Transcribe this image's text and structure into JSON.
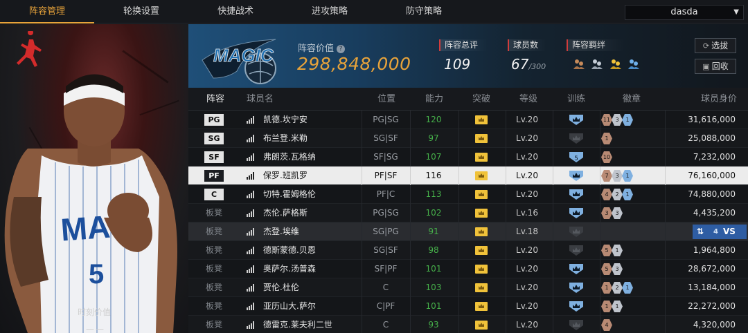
{
  "tabs": [
    {
      "label": "阵容管理",
      "active": true
    },
    {
      "label": "轮换设置",
      "active": false
    },
    {
      "label": "快捷战术",
      "active": false
    },
    {
      "label": "进攻策略",
      "active": false
    },
    {
      "label": "防守策略",
      "active": false
    }
  ],
  "account": {
    "selected": "dasda"
  },
  "portrait": {
    "moment_label": "时刻价值",
    "moment_value": "——"
  },
  "team": {
    "value_label": "阵容价值",
    "value": "298,848,000",
    "rating_label": "阵容总评",
    "rating": "109",
    "players_label": "球员数",
    "players": "67",
    "players_max": "/300",
    "bond_label": "阵容羁绊",
    "bond_icons": [
      "bond-icon-1",
      "bond-icon-2",
      "bond-icon-3",
      "bond-icon-4"
    ],
    "select_label": "选拔",
    "recycle_label": "回收"
  },
  "table": {
    "headers": [
      "阵容",
      "球员名",
      "位置",
      "能力",
      "突破",
      "等级",
      "训练",
      "徽章",
      "球员身价"
    ],
    "rows": [
      {
        "slot": "PG",
        "name": "凯德.坎宁安",
        "pos": "PG|SG",
        "ability": "120",
        "level": "Lv.20",
        "badges": [
          {
            "n": "11",
            "t": "b"
          },
          {
            "n": "3",
            "t": "s"
          },
          {
            "n": "1",
            "t": "g"
          }
        ],
        "price": "31,616,000",
        "train": "active"
      },
      {
        "slot": "SG",
        "name": "布兰登.米勒",
        "pos": "SG|SF",
        "ability": "97",
        "level": "Lv.20",
        "badges": [
          {
            "n": "1",
            "t": "b"
          }
        ],
        "price": "25,088,000",
        "train": "inactive"
      },
      {
        "slot": "SF",
        "name": "弗朗茨.瓦格纳",
        "pos": "SF|SG",
        "ability": "107",
        "level": "Lv.20",
        "badges": [
          {
            "n": "10",
            "t": "b"
          }
        ],
        "price": "7,232,000",
        "train": "number",
        "train_num": "5"
      },
      {
        "slot": "PF",
        "name": "保罗.班凯罗",
        "pos": "PF|SF",
        "ability": "116",
        "level": "Lv.20",
        "badges": [
          {
            "n": "7",
            "t": "b"
          },
          {
            "n": "3",
            "t": "s"
          },
          {
            "n": "1",
            "t": "g"
          }
        ],
        "price": "76,160,000",
        "train": "active"
      },
      {
        "slot": "C",
        "name": "切特.霍姆格伦",
        "pos": "PF|C",
        "ability": "113",
        "level": "Lv.20",
        "badges": [
          {
            "n": "4",
            "t": "b"
          },
          {
            "n": "2",
            "t": "s"
          },
          {
            "n": "1",
            "t": "g"
          }
        ],
        "price": "74,880,000",
        "train": "active"
      },
      {
        "slot": "板凳",
        "name": "杰伦.萨格斯",
        "pos": "PG|SG",
        "ability": "102",
        "level": "Lv.16",
        "badges": [
          {
            "n": "3",
            "t": "b"
          },
          {
            "n": "3",
            "t": "s"
          }
        ],
        "price": "4,435,200",
        "train": "active"
      },
      {
        "slot": "板凳",
        "name": "杰登.埃维",
        "pos": "SG|PG",
        "ability": "91",
        "level": "Lv.18",
        "badges": [],
        "price": "",
        "train": "inactive",
        "swap": true
      },
      {
        "slot": "板凳",
        "name": "德斯蒙德.贝恩",
        "pos": "SG|SF",
        "ability": "98",
        "level": "Lv.20",
        "badges": [
          {
            "n": "5",
            "t": "b"
          },
          {
            "n": "1",
            "t": "s"
          }
        ],
        "price": "1,964,800",
        "train": "inactive"
      },
      {
        "slot": "板凳",
        "name": "奥萨尔.汤普森",
        "pos": "SF|PF",
        "ability": "101",
        "level": "Lv.20",
        "badges": [
          {
            "n": "5",
            "t": "b"
          },
          {
            "n": "3",
            "t": "s"
          }
        ],
        "price": "28,672,000",
        "train": "active"
      },
      {
        "slot": "板凳",
        "name": "贾伦.杜伦",
        "pos": "C",
        "ability": "103",
        "level": "Lv.20",
        "badges": [
          {
            "n": "1",
            "t": "b"
          },
          {
            "n": "2",
            "t": "s"
          },
          {
            "n": "1",
            "t": "g"
          }
        ],
        "price": "13,184,000",
        "train": "active"
      },
      {
        "slot": "板凳",
        "name": "亚历山大.萨尔",
        "pos": "C|PF",
        "ability": "101",
        "level": "Lv.20",
        "badges": [
          {
            "n": "1",
            "t": "b"
          },
          {
            "n": "1",
            "t": "s"
          }
        ],
        "price": "22,272,000",
        "train": "active"
      },
      {
        "slot": "板凳",
        "name": "德雷克.莱夫利二世",
        "pos": "C",
        "ability": "93",
        "level": "Lv.20",
        "badges": [
          {
            "n": "4",
            "t": "b"
          }
        ],
        "price": "4,320,000",
        "train": "inactive"
      }
    ],
    "swap_label": "VS"
  },
  "colors": {
    "accent": "#e8a33a",
    "ability_green": "#46b04a",
    "selected_row": "#ececec",
    "swap_blue": "#2e5da3"
  }
}
